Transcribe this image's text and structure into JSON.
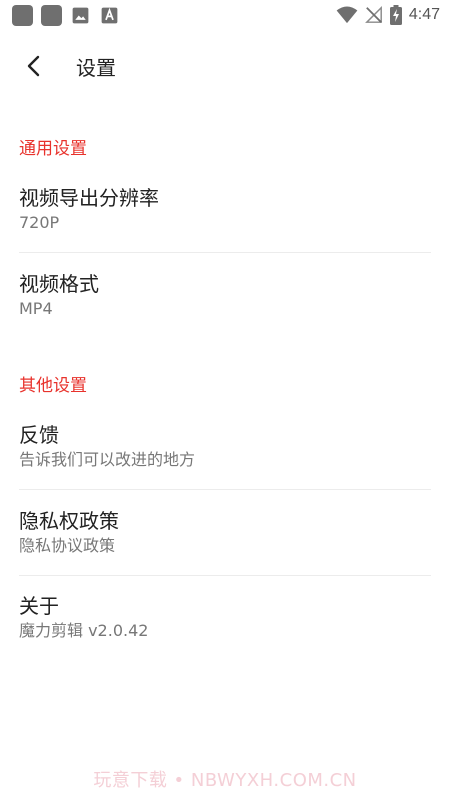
{
  "status_bar": {
    "time": "4:47",
    "icons": [
      "app-notification-icon",
      "app-notification-icon",
      "image-icon",
      "text-icon",
      "wifi-icon",
      "no-signal-icon",
      "battery-charging-icon"
    ]
  },
  "toolbar": {
    "back_icon": "back-arrow-icon",
    "title": "设置"
  },
  "sections": [
    {
      "header": "通用设置",
      "items": [
        {
          "title": "视频导出分辨率",
          "subtitle": "720P"
        },
        {
          "title": "视频格式",
          "subtitle": "MP4"
        }
      ]
    },
    {
      "header": "其他设置",
      "items": [
        {
          "title": "反馈",
          "subtitle": "告诉我们可以改进的地方"
        },
        {
          "title": "隐私权政策",
          "subtitle": "隐私协议政策"
        },
        {
          "title": "关于",
          "subtitle": "魔力剪辑 v2.0.42"
        }
      ]
    }
  ],
  "watermark": "玩意下载 • NBWYXH.COM.CN",
  "colors": {
    "accent": "#e8322c",
    "text_primary": "#222222",
    "text_secondary": "#777777",
    "divider": "#ececec"
  }
}
